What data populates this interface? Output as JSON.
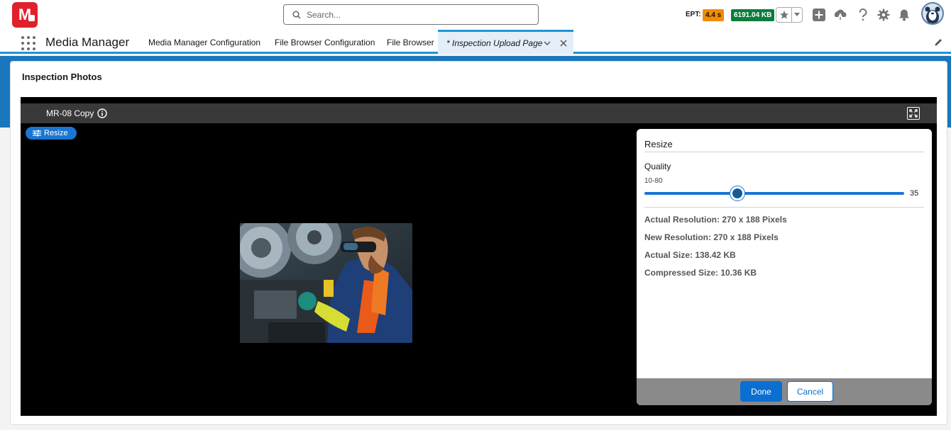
{
  "header": {
    "logo_text": "M",
    "search_placeholder": "Search...",
    "ept_label": "EPT:",
    "ept_value": "4.4 s",
    "kb_value": "6191.04 KB",
    "icons": [
      "star-icon",
      "chevron-down-icon",
      "add-icon",
      "trailhead-icon",
      "help-icon",
      "gear-icon",
      "bell-icon",
      "avatar"
    ]
  },
  "nav": {
    "app_name": "Media Manager",
    "items": [
      {
        "label": "Media Manager Configuration"
      },
      {
        "label": "File Browser Configuration"
      },
      {
        "label": "File Browser"
      }
    ],
    "active_tab": {
      "label": "* Inspection Upload Page"
    }
  },
  "card": {
    "title": "Inspection Photos"
  },
  "viewer": {
    "title": "MR-08 Copy",
    "resize_label": "Resize"
  },
  "panel": {
    "title": "Resize",
    "quality_label": "Quality",
    "quality_range": "10-80",
    "quality_value": "35",
    "quality_min": 10,
    "quality_max": 80,
    "actual_resolution": "Actual Resolution: 270 x 188 Pixels",
    "new_resolution": "New Resolution: 270 x 188 Pixels",
    "actual_size": "Actual Size: 138.42 KB",
    "compressed_size": "Compressed Size: 10.36 KB",
    "done_label": "Done",
    "cancel_label": "Cancel"
  },
  "colors": {
    "brand_red": "#e0202c",
    "accent_blue": "#0b6ed1",
    "ept_orange": "#f28b00",
    "kb_green": "#0b7d3e"
  }
}
